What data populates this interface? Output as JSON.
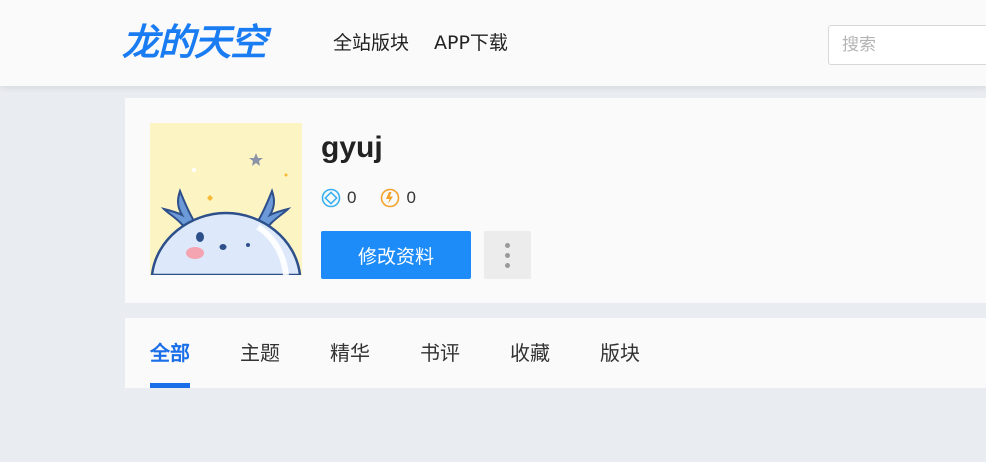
{
  "header": {
    "logo_text": "龙的天空",
    "nav": [
      {
        "label": "全站版块"
      },
      {
        "label": "APP下载"
      }
    ],
    "search_placeholder": "搜索"
  },
  "profile": {
    "username": "gyuj",
    "stats": [
      {
        "icon": "diamond-coin-icon",
        "value": "0",
        "color": "#3ab0f0"
      },
      {
        "icon": "lightning-coin-icon",
        "value": "0",
        "color": "#f2a22b"
      }
    ],
    "edit_label": "修改资料",
    "more_icon": "vertical-ellipsis-icon"
  },
  "tabs": [
    {
      "label": "全部",
      "active": true
    },
    {
      "label": "主题",
      "active": false
    },
    {
      "label": "精华",
      "active": false
    },
    {
      "label": "书评",
      "active": false
    },
    {
      "label": "收藏",
      "active": false
    },
    {
      "label": "版块",
      "active": false
    }
  ],
  "colors": {
    "accent": "#1a6fe8",
    "button": "#1d8cf8",
    "background": "#e9ecf0"
  }
}
